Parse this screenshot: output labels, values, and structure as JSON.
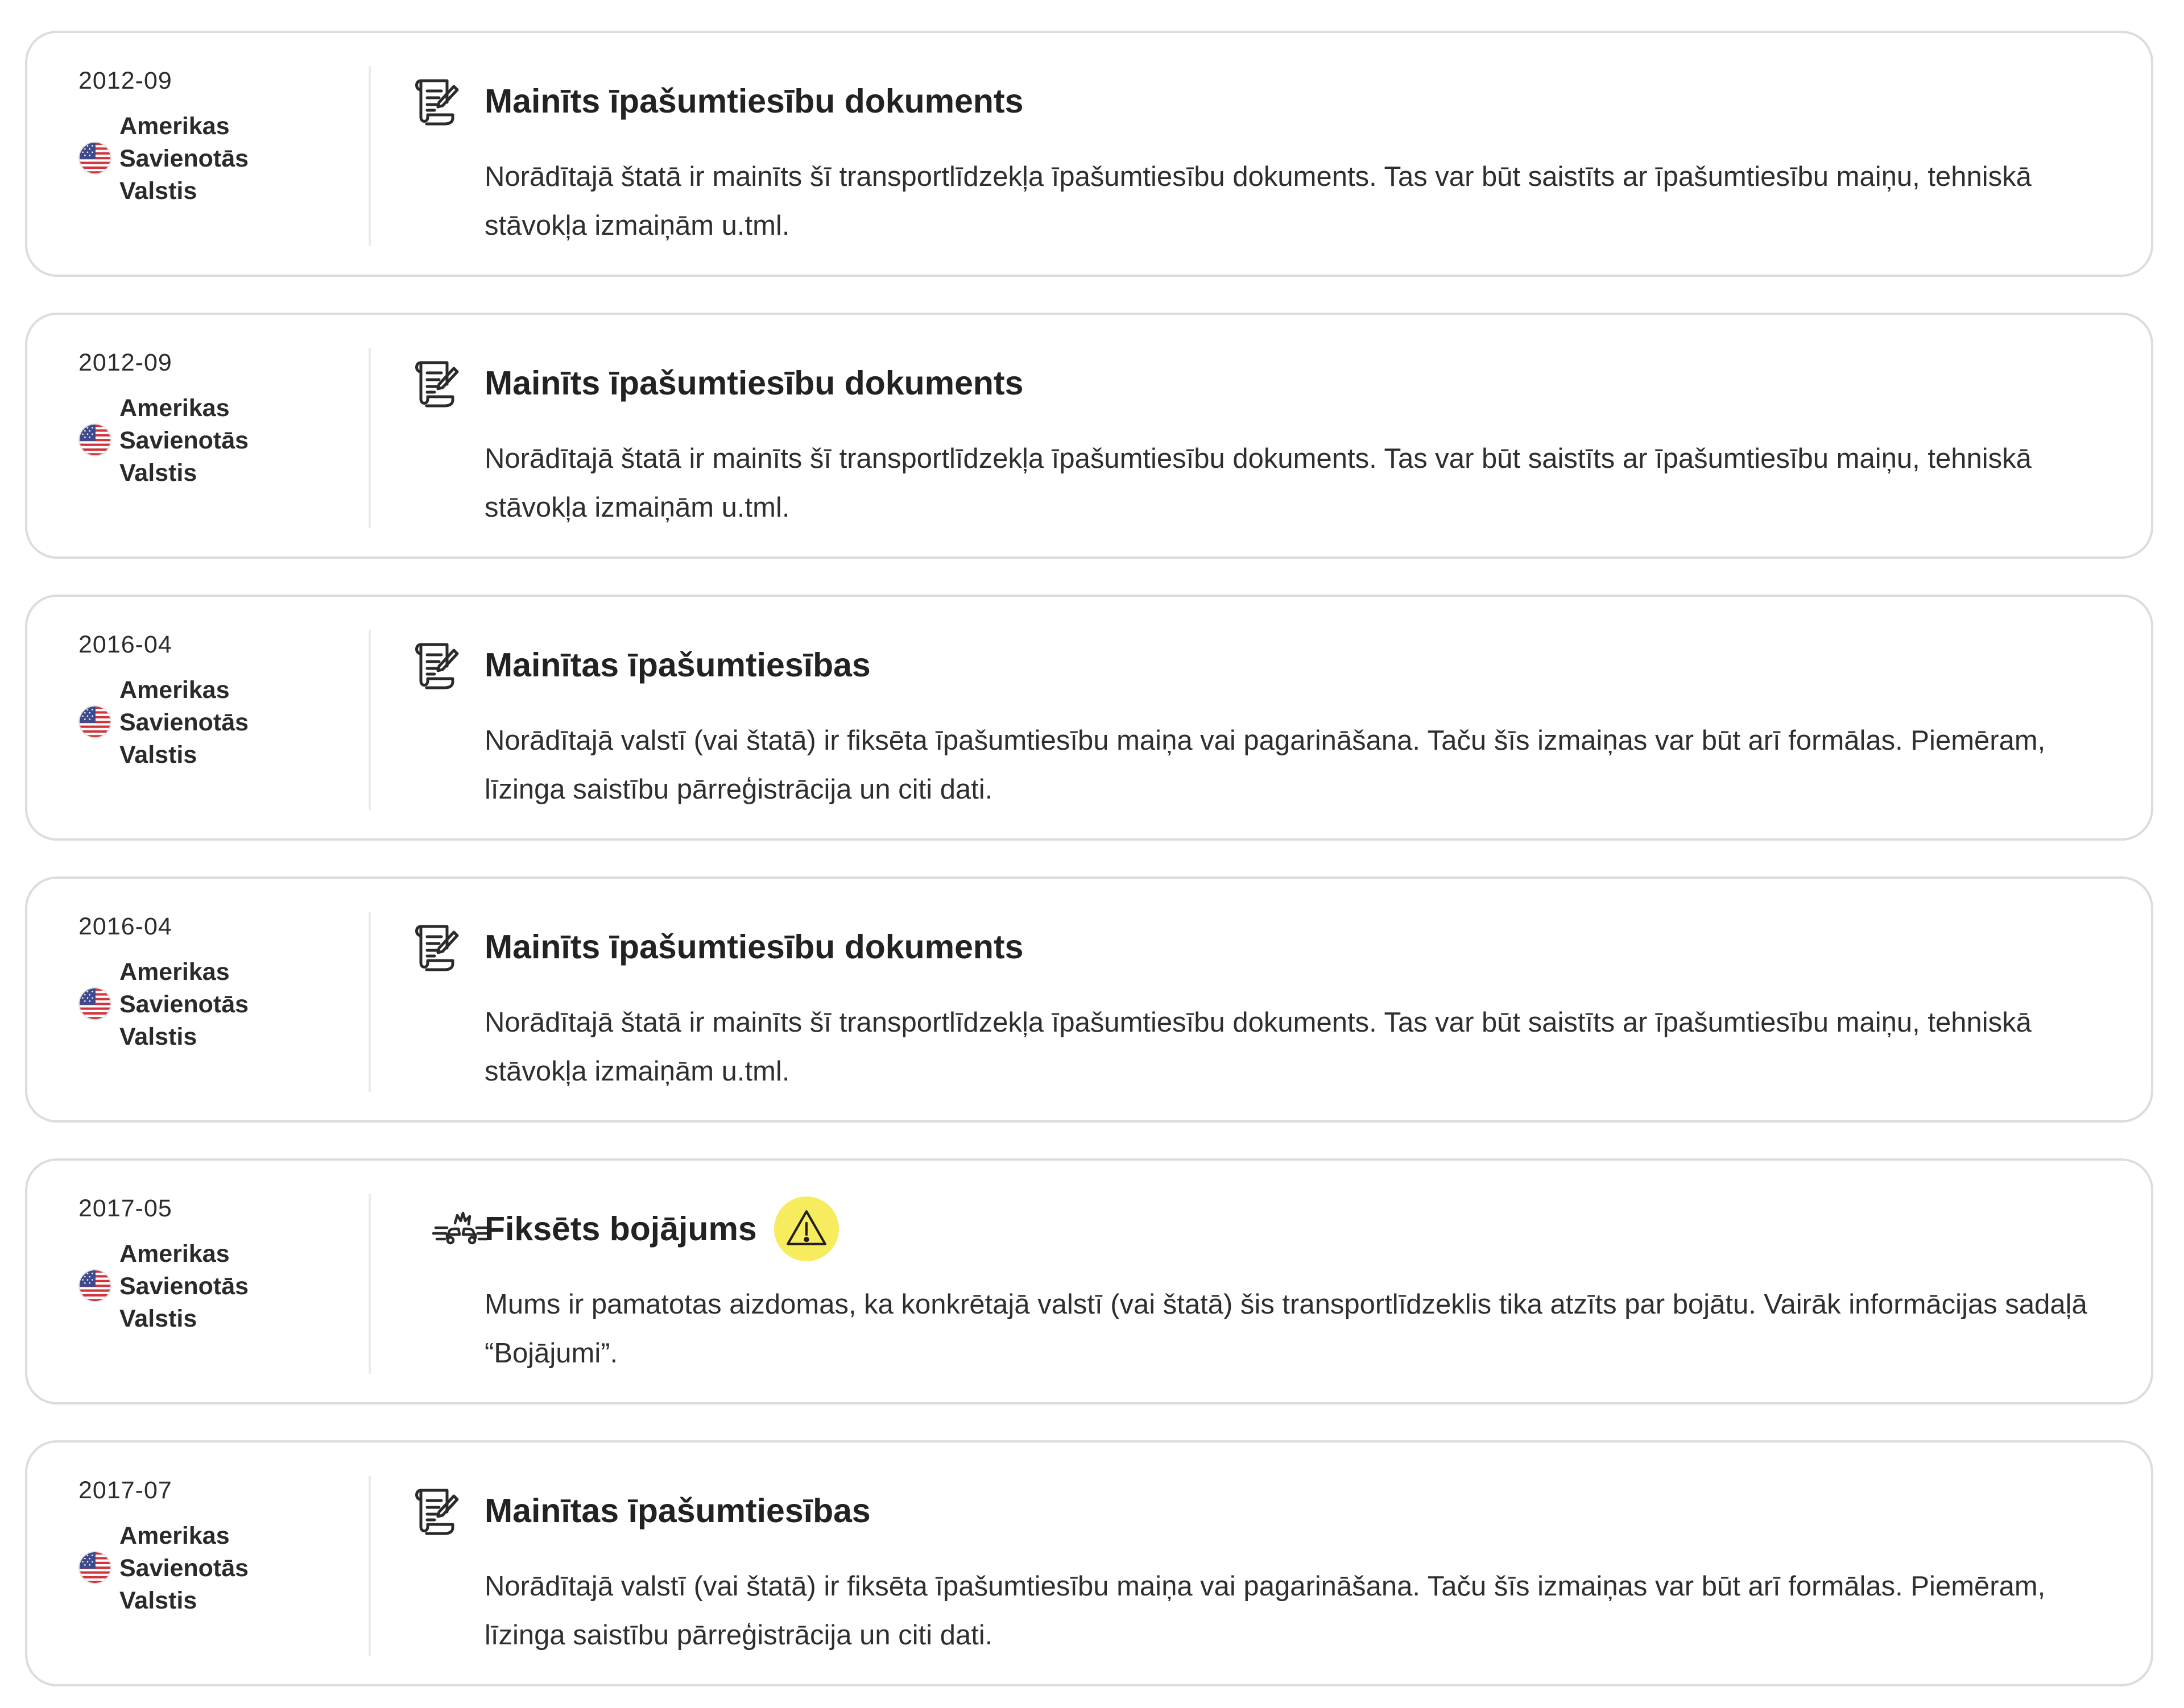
{
  "events": [
    {
      "date": "2012-09",
      "country": "Amerikas\nSavienotās\nValstis",
      "icon": "document-edit-icon",
      "title": "Mainīts īpašumtiesību dokuments",
      "warning": false,
      "description": "Norādītajā štatā ir mainīts šī transportlīdzekļa īpašumtiesību dokuments. Tas var būt saistīts ar īpašumtiesību maiņu, tehniskā stāvokļa izmaiņām u.tml."
    },
    {
      "date": "2012-09",
      "country": "Amerikas\nSavienotās\nValstis",
      "icon": "document-edit-icon",
      "title": "Mainīts īpašumtiesību dokuments",
      "warning": false,
      "description": "Norādītajā štatā ir mainīts šī transportlīdzekļa īpašumtiesību dokuments. Tas var būt saistīts ar īpašumtiesību maiņu, tehniskā stāvokļa izmaiņām u.tml."
    },
    {
      "date": "2016-04",
      "country": "Amerikas\nSavienotās\nValstis",
      "icon": "document-edit-icon",
      "title": "Mainītas īpašumtiesības",
      "warning": false,
      "description": "Norādītajā valstī (vai štatā) ir fiksēta īpašumtiesību maiņa vai pagarināšana. Taču šīs izmaiņas var būt arī formālas. Piemēram, līzinga saistību pārreģistrācija un citi dati."
    },
    {
      "date": "2016-04",
      "country": "Amerikas\nSavienotās\nValstis",
      "icon": "document-edit-icon",
      "title": "Mainīts īpašumtiesību dokuments",
      "warning": false,
      "description": "Norādītajā štatā ir mainīts šī transportlīdzekļa īpašumtiesību dokuments. Tas var būt saistīts ar īpašumtiesību maiņu, tehniskā stāvokļa izmaiņām u.tml."
    },
    {
      "date": "2017-05",
      "country": "Amerikas\nSavienotās\nValstis",
      "icon": "car-crash-icon",
      "title": "Fiksēts bojājums",
      "warning": true,
      "description": "Mums ir pamatotas aizdomas, ka konkrētajā valstī (vai štatā) šis transportlīdzeklis tika atzīts par bojātu. Vairāk informācijas sadaļā “Bojājumi”."
    },
    {
      "date": "2017-07",
      "country": "Amerikas\nSavienotās\nValstis",
      "icon": "document-edit-icon",
      "title": "Mainītas īpašumtiesības",
      "warning": false,
      "description": "Norādītajā valstī (vai štatā) ir fiksēta īpašumtiesību maiņa vai pagarināšana. Taču šīs izmaiņas var būt arī formālas. Piemēram, līzinga saistību pārreģistrācija un citi dati."
    }
  ],
  "colors": {
    "card_border": "#dcdcdc",
    "warning_badge": "#f7eb5e",
    "text": "#222222"
  }
}
